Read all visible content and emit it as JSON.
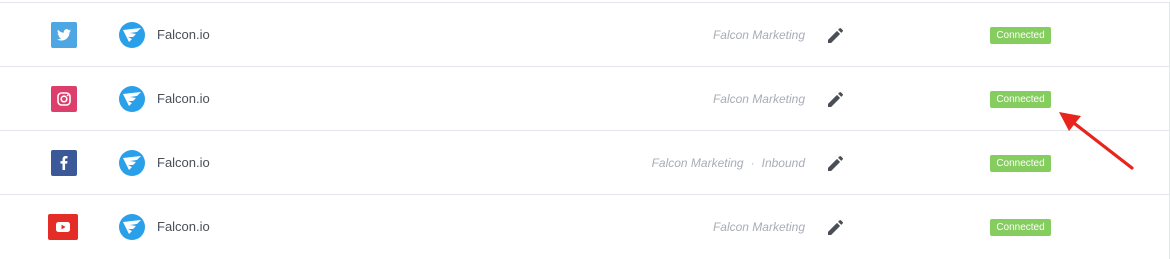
{
  "rows": [
    {
      "network_icon": "twitter-icon",
      "account": "Falcon.io",
      "owner": "Falcon Marketing",
      "owner_extra": "",
      "status": "Connected"
    },
    {
      "network_icon": "instagram-icon",
      "account": "Falcon.io",
      "owner": "Falcon Marketing",
      "owner_extra": "",
      "status": "Connected"
    },
    {
      "network_icon": "facebook-icon",
      "account": "Falcon.io",
      "owner": "Falcon Marketing",
      "owner_extra": "Inbound",
      "status": "Connected"
    },
    {
      "network_icon": "youtube-icon",
      "account": "Falcon.io",
      "owner": "Falcon Marketing",
      "owner_extra": "",
      "status": "Connected"
    }
  ],
  "separator": "·",
  "colors": {
    "twitter": "#4ea6e2",
    "instagram": "#dd3f6c",
    "facebook": "#3b5998",
    "youtube": "#e52d27",
    "brand": "#2a9fea",
    "status_connected": "#84cd5e",
    "annotation_arrow": "#e8241d"
  },
  "annotation": {
    "type": "arrow",
    "points_to": "instagram-connected-status"
  }
}
